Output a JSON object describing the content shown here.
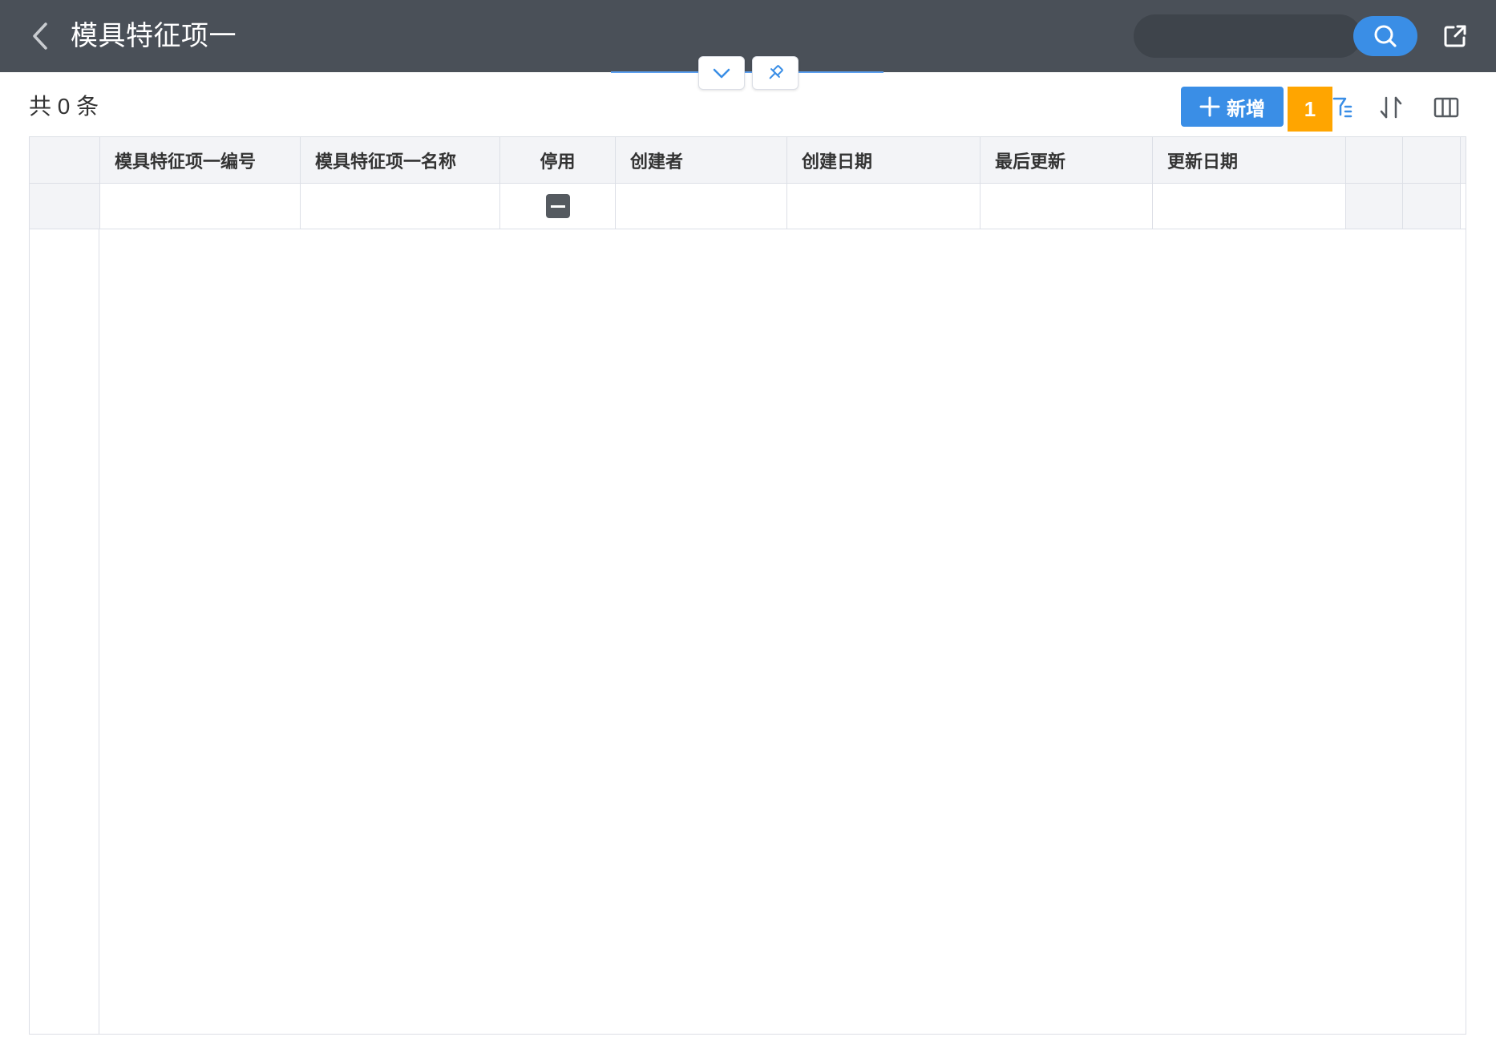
{
  "header": {
    "title": "模具特征项一",
    "search_placeholder": ""
  },
  "toolbar": {
    "total_label": "共 0 条",
    "add_label": "新增",
    "badge_count": "1"
  },
  "table": {
    "columns": [
      "模具特征项一编号",
      "模具特征项一名称",
      "停用",
      "创建者",
      "创建日期",
      "最后更新",
      "更新日期",
      "",
      ""
    ],
    "rows": []
  },
  "colors": {
    "header_bg": "#4a5058",
    "accent": "#3a8ee6",
    "badge": "#ffa500"
  },
  "icons": [
    "back-arrow-icon",
    "search-icon",
    "share-icon",
    "chevron-down-icon",
    "pin-icon",
    "filter-icon",
    "sort-icon",
    "columns-icon",
    "minus-icon",
    "plus-icon"
  ]
}
